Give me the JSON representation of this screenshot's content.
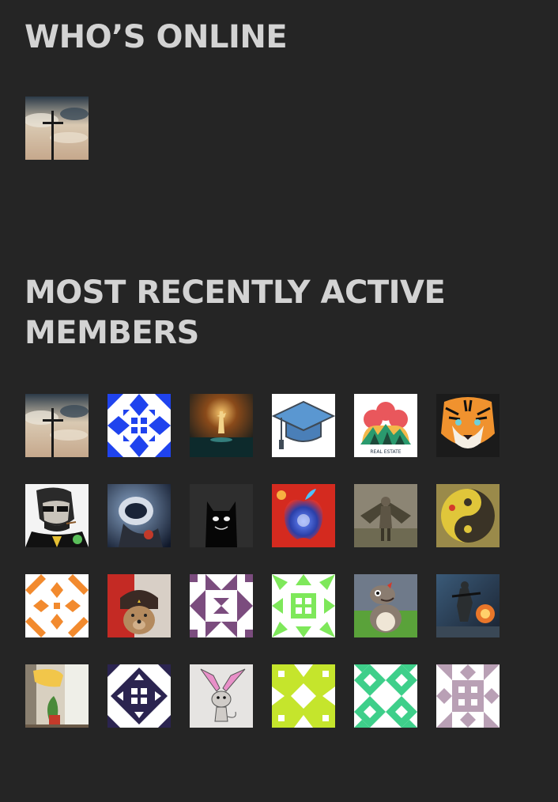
{
  "whos_online": {
    "title": "WHO’S ONLINE",
    "members": [
      {
        "avatar": "cross-sky-avatar"
      }
    ]
  },
  "recently_active": {
    "title": "MOST RECENTLY ACTIVE MEMBERS",
    "members": [
      {
        "avatar": "cross-sky-avatar"
      },
      {
        "avatar": "blue-pattern-avatar"
      },
      {
        "avatar": "glowing-figure-avatar"
      },
      {
        "avatar": "graduation-cap-avatar"
      },
      {
        "avatar": "real-estate-logo-avatar",
        "text": "REAL ESTATE"
      },
      {
        "avatar": "tiger-avatar"
      },
      {
        "avatar": "lincoln-sunglasses-avatar"
      },
      {
        "avatar": "space-creature-avatar"
      },
      {
        "avatar": "black-cat-avatar"
      },
      {
        "avatar": "cosmic-apple-avatar"
      },
      {
        "avatar": "winged-figure-avatar"
      },
      {
        "avatar": "yin-yang-avatar"
      },
      {
        "avatar": "orange-pattern-avatar"
      },
      {
        "avatar": "bear-hat-avatar"
      },
      {
        "avatar": "purple-pattern-avatar"
      },
      {
        "avatar": "green-pattern-avatar"
      },
      {
        "avatar": "cartoon-dinosaur-avatar"
      },
      {
        "avatar": "soldier-battlefield-avatar"
      },
      {
        "avatar": "plant-window-avatar"
      },
      {
        "avatar": "navy-pattern-avatar"
      },
      {
        "avatar": "bunny-sketch-avatar"
      },
      {
        "avatar": "lime-pattern-avatar"
      },
      {
        "avatar": "teal-pattern-avatar"
      },
      {
        "avatar": "mauve-pattern-avatar"
      }
    ]
  },
  "colors": {
    "background": "#252525",
    "heading": "#d3d3d3",
    "pattern_blue": "#1f43ee",
    "pattern_orange": "#f28a2e",
    "pattern_purple": "#7b4c7e",
    "pattern_green": "#7ee85a",
    "pattern_navy": "#2b2450",
    "pattern_lime": "#c5e52c",
    "pattern_teal": "#3ecf8a",
    "pattern_mauve": "#b9a0b5"
  }
}
